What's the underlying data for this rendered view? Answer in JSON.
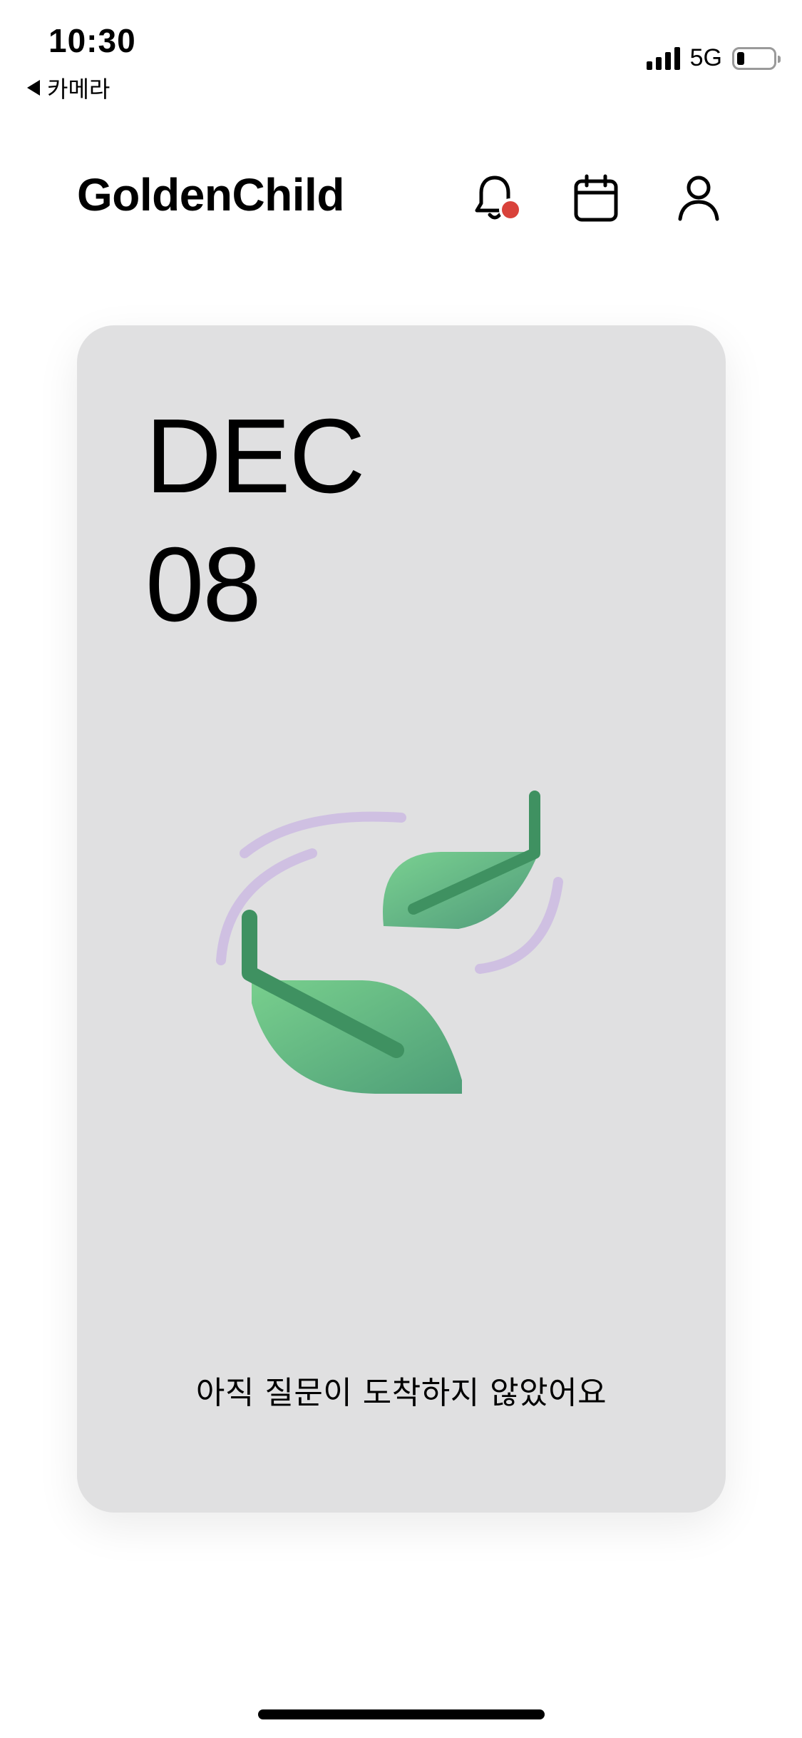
{
  "status_bar": {
    "time": "10:30",
    "back_app": "카메라",
    "network": "5G",
    "battery_level": 0.15
  },
  "header": {
    "title": "GoldenChild",
    "notification_badge_color": "#d9423b",
    "icons": [
      "bell-icon",
      "calendar-icon",
      "person-icon"
    ]
  },
  "card": {
    "month": "DEC",
    "day": "08",
    "illustration": "leaves-icon",
    "message": "아직 질문이 도착하지 않았어요",
    "background": "#e0e0e1"
  }
}
